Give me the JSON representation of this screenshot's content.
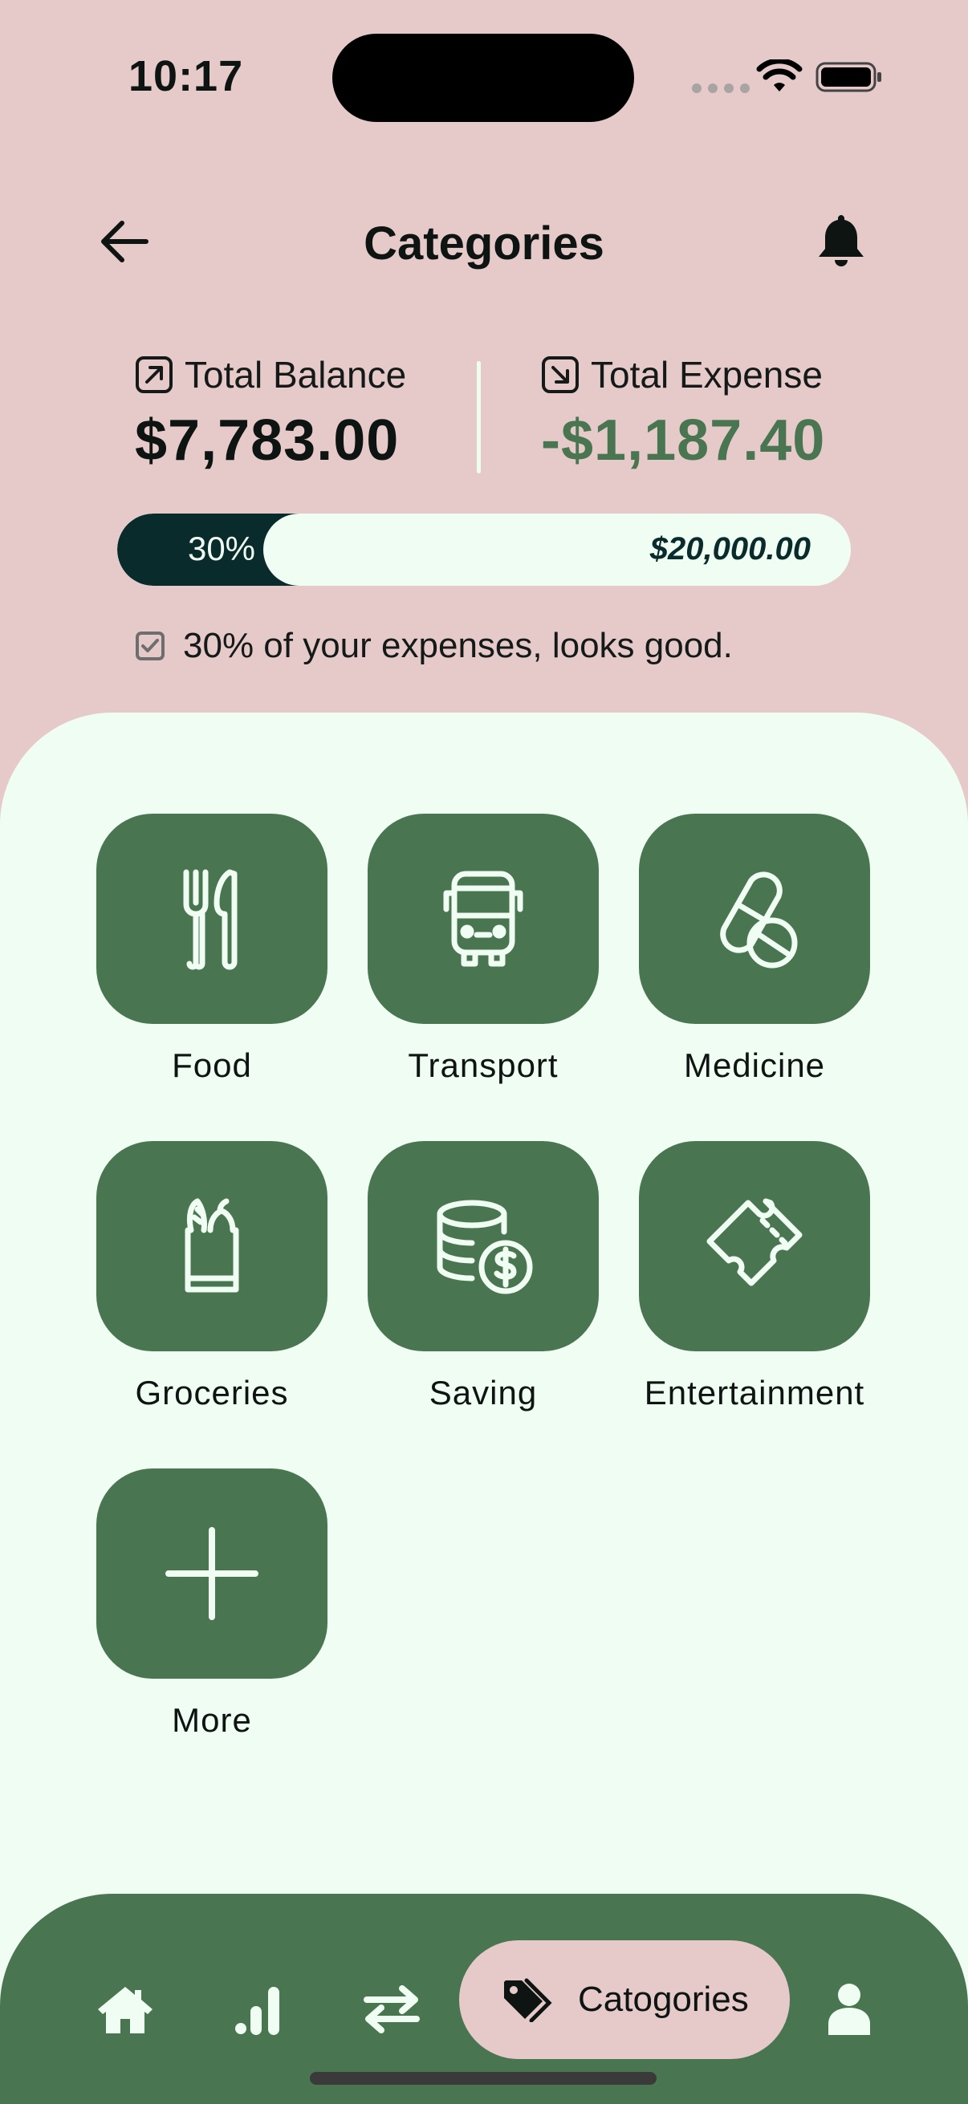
{
  "status_bar": {
    "time": "10:17"
  },
  "header": {
    "title": "Categories"
  },
  "summary": {
    "balance_label": "Total Balance",
    "balance_value": "$7,783.00",
    "expense_label": "Total Expense",
    "expense_value": "-$1,187.40",
    "progress_percent_label": "30%",
    "progress_fraction": 0.3,
    "progress_target": "$20,000.00",
    "note": "30% of your expenses, looks good."
  },
  "categories": [
    {
      "label": "Food",
      "icon": "utensils-icon"
    },
    {
      "label": "Transport",
      "icon": "bus-icon"
    },
    {
      "label": "Medicine",
      "icon": "pill-icon"
    },
    {
      "label": "Groceries",
      "icon": "grocery-bag-icon"
    },
    {
      "label": "Saving",
      "icon": "coins-dollar-icon"
    },
    {
      "label": "Entertainment",
      "icon": "ticket-icon"
    },
    {
      "label": "More",
      "icon": "plus-icon"
    }
  ],
  "bottom_nav": {
    "items": [
      "home-icon",
      "analysis-icon",
      "transactions-icon",
      "category-tag-icon",
      "profile-icon"
    ],
    "active_label": "Catogories"
  },
  "colors": {
    "background": "#E6CACA",
    "panel": "#F0FDF2",
    "accent_green": "#4A7551",
    "dark_teal": "#0A2B2B"
  }
}
